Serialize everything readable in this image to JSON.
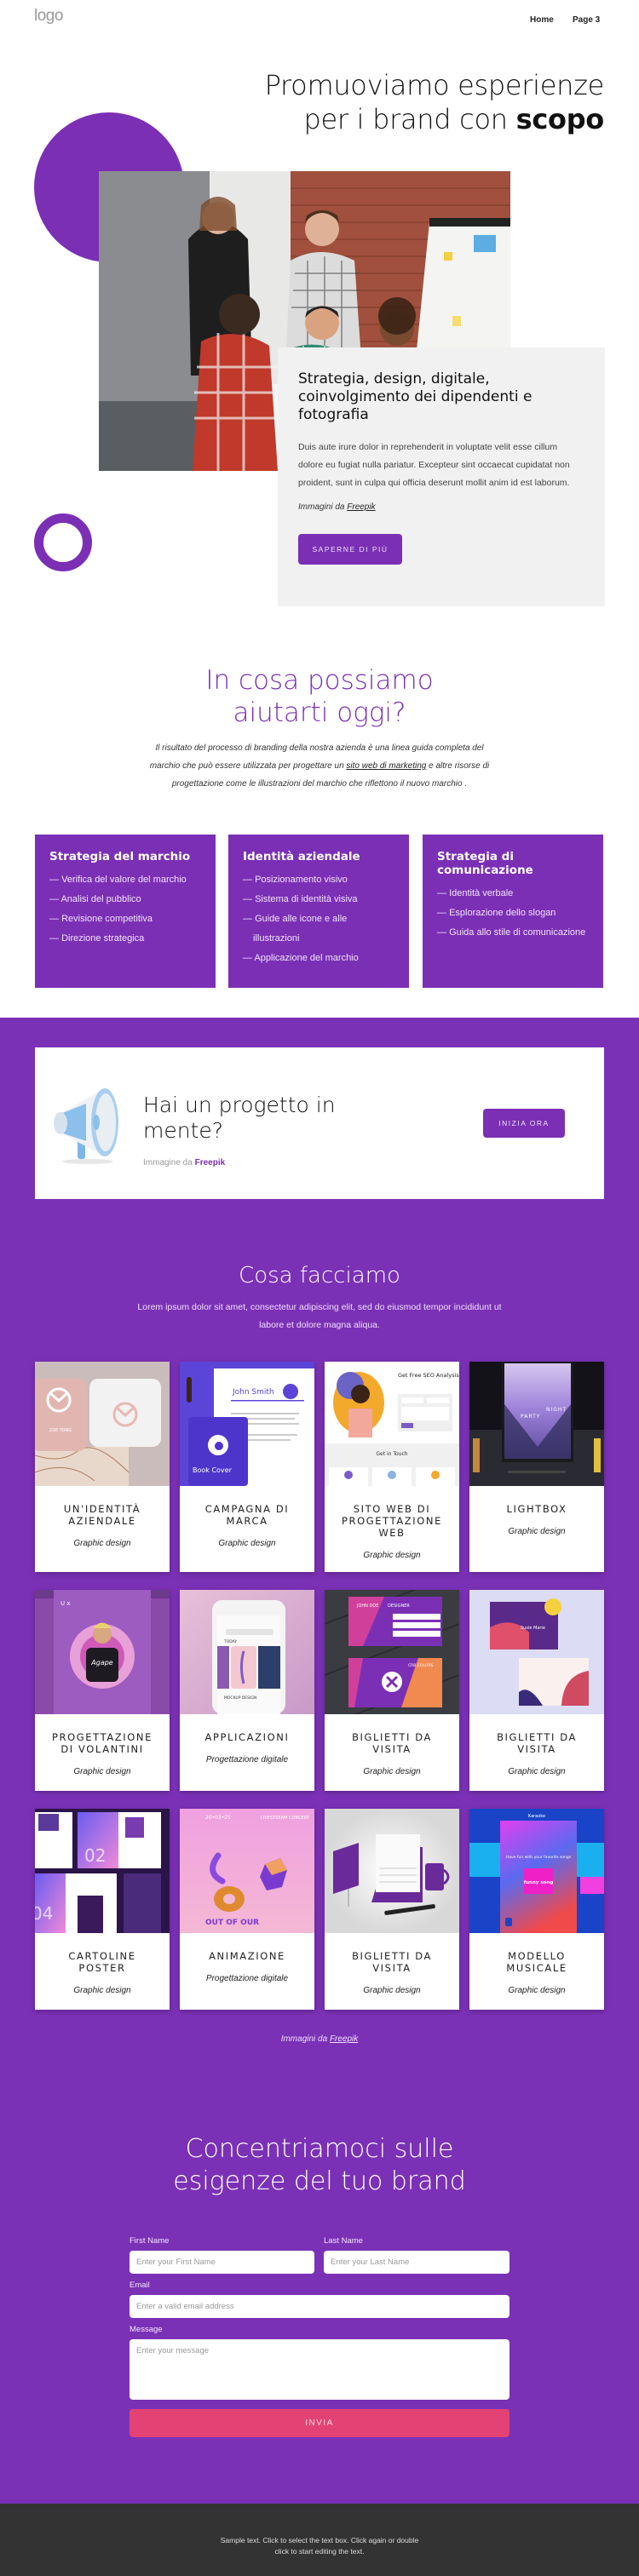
{
  "header": {
    "logo": "logo",
    "nav": [
      {
        "label": "Home"
      },
      {
        "label": "Page 3"
      }
    ]
  },
  "hero": {
    "title_line1": "Promuoviamo esperienze",
    "title_line2_prefix": "per i brand con ",
    "title_line2_bold": "scopo",
    "photo_alt": "Team of five colleagues brainstorming at a table near a whiteboard and brick wall",
    "card": {
      "heading": "Strategia, design, digitale, coinvolgimento dei dipendenti e fotografia",
      "body": "Duis aute irure dolor in reprehenderit in voluptate velit esse cillum dolore eu fugiat nulla pariatur. Excepteur sint occaecat cupidatat non proident, sunt in culpa qui officia deserunt mollit anim id est laborum.",
      "credit_prefix": "Immagini da ",
      "credit_link": "Freepik",
      "button": "SAPERNE DI PIÙ"
    }
  },
  "help": {
    "title_line1": "In cosa possiamo",
    "title_line2": "aiutarti oggi?",
    "desc_before": "Il risultato del processo di branding della nostra azienda è una linea guida completa del marchio che può essere utilizzata per progettare un ",
    "desc_link": "sito web di marketing",
    "desc_after": " e altre risorse di progettazione come le illustrazioni del marchio che riflettono il nuovo marchio .",
    "services": [
      {
        "title": "Strategia del marchio",
        "items": [
          "Verifica del valore del marchio",
          "Analisi del pubblico",
          "Revisione competitiva",
          "Direzione strategica"
        ]
      },
      {
        "title": "Identità aziendale",
        "items": [
          "Posizionamento visivo",
          "Sistema di identità visiva",
          "Guide alle icone e alle illustrazioni",
          "Applicazione del marchio"
        ]
      },
      {
        "title": "Strategia di comunicazione",
        "items": [
          "Identità verbale",
          "Esplorazione dello slogan",
          "Guida allo stile di comunicazione"
        ]
      }
    ]
  },
  "cta": {
    "title_line1": "Hai un progetto in",
    "title_line2": "mente?",
    "credit_prefix": "Immagine da ",
    "credit_link": "Freepik",
    "button": "INIZIA ORA"
  },
  "what": {
    "title": "Cosa facciamo",
    "desc": "Lorem ipsum dolor sit amet, consectetur adipiscing elit, sed do eiusmod tempor incididunt ut labore et dolore magna aliqua.",
    "cards": [
      {
        "title": "UN'IDENTITÀ AZIENDALE",
        "subtitle": "Graphic design"
      },
      {
        "title": "CAMPAGNA DI MARCA",
        "subtitle": "Graphic design"
      },
      {
        "title": "SITO WEB DI PROGETTAZIONE WEB",
        "subtitle": "Graphic design"
      },
      {
        "title": "LIGHTBOX",
        "subtitle": "Graphic design"
      },
      {
        "title": "PROGETTAZIONE DI VOLANTINI",
        "subtitle": "Graphic design"
      },
      {
        "title": "APPLICAZIONI",
        "subtitle": "Progettazione digitale"
      },
      {
        "title": "BIGLIETTI DA VISITA",
        "subtitle": "Graphic design"
      },
      {
        "title": "BIGLIETTI DA VISITA",
        "subtitle": "Graphic design"
      },
      {
        "title": "CARTOLINE POSTER",
        "subtitle": "Graphic design"
      },
      {
        "title": "ANIMAZIONE",
        "subtitle": "Progettazione digitale"
      },
      {
        "title": "BIGLIETTI DA VISITA",
        "subtitle": "Graphic design"
      },
      {
        "title": "MODELLO MUSICALE",
        "subtitle": "Graphic design"
      }
    ],
    "thumb_texts": {
      "c1": "ZOE YONG",
      "c2_name": "John Smith",
      "c2_book": "Book Cover",
      "c3_head": "Get Free SEO Analysis?",
      "c3_touch": "Get in Touch",
      "c4_night": "NIGHT",
      "c4_party": "PARTY",
      "c5": "Agape",
      "c6_today": "TODAY",
      "c6_mockup": "MOCKUP DESIGN",
      "c7_name": "JOHN DOE",
      "c7_role": "DESIGNER",
      "c7_brand": "CRB COLORS",
      "c8_name": "Susie Marie",
      "c9_num1": "02",
      "c9_num2": "04",
      "c10_date": "20•03•21",
      "c10_event": "LIVESTREAM CONCERT",
      "c10_bottom": "OUT OF OUR",
      "c12_label": "Karaoke",
      "c12_tag": "Have fun with your favorite songs",
      "c12_funny": "funny song"
    },
    "credit_prefix": "Immagini da ",
    "credit_link": "Freepik"
  },
  "form": {
    "title_line1": "Concentriamoci sulle",
    "title_line2": "esigenze del tuo brand",
    "first_name": {
      "label": "First Name",
      "placeholder": "Enter your First Name",
      "value": ""
    },
    "last_name": {
      "label": "Last Name",
      "placeholder": "Enter your Last Name",
      "value": ""
    },
    "email": {
      "label": "Email",
      "placeholder": "Enter a valid email address",
      "value": ""
    },
    "message": {
      "label": "Message",
      "placeholder": "Enter your message",
      "value": ""
    },
    "submit": "INVIA"
  },
  "footer": {
    "text": "Sample text. Click to select the text box. Click again or double click to start editing the text."
  },
  "colors": {
    "brand_purple": "#7b31b6",
    "accent_pink": "#e24374",
    "footer_bg": "#333333",
    "hero_card_bg": "#f1f1f1"
  }
}
